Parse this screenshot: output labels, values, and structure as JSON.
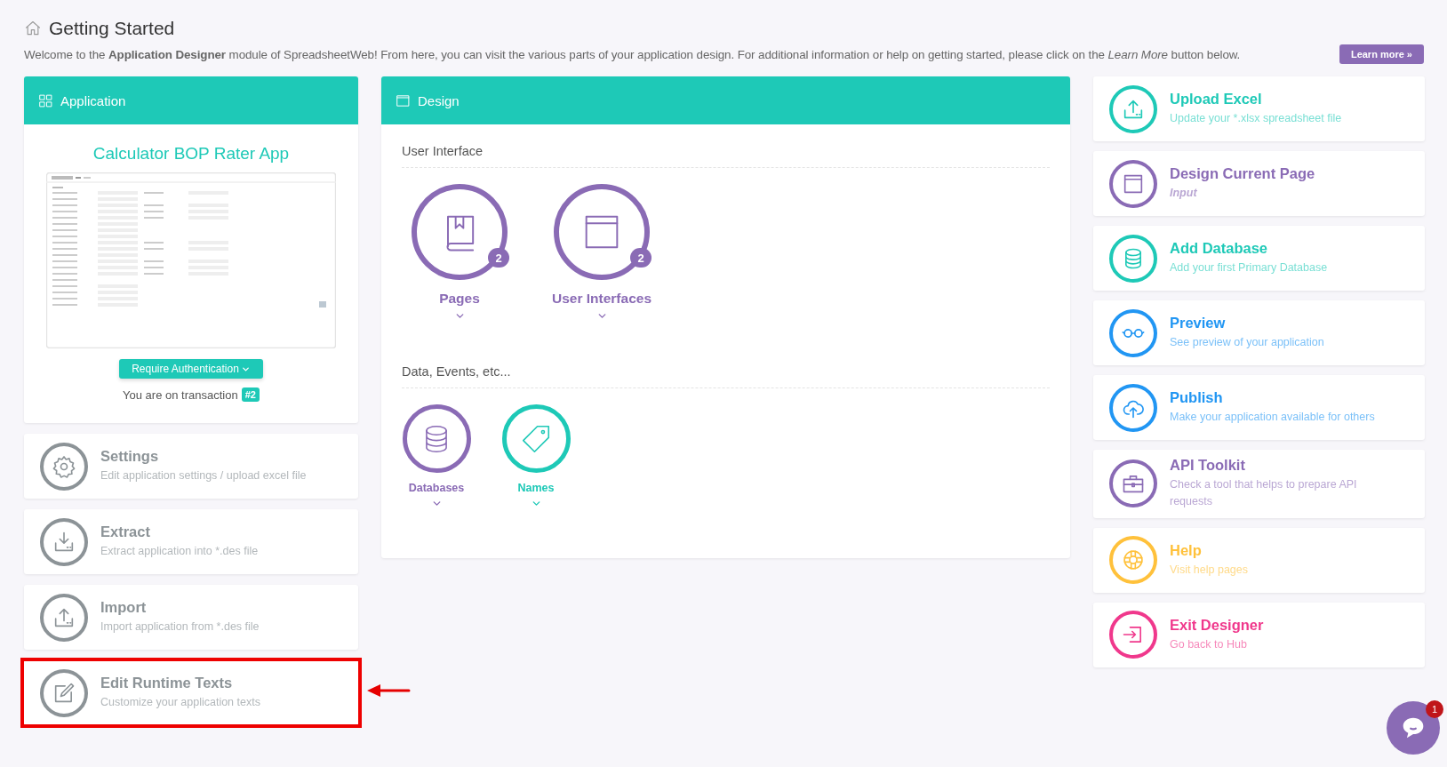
{
  "header": {
    "title": "Getting Started",
    "description": "Welcome to the **Application Designer** module of SpreadsheetWeb! From here, you can visit the various parts of your application design. For additional information or help on getting started, please click on the *Learn More* button below.",
    "learn_more": "Learn more »"
  },
  "application": {
    "title": "Application",
    "app_name": "Calculator BOP Rater App",
    "auth_button": "Require Authentication",
    "transaction_label": "You are on transaction",
    "transaction_badge": "#2"
  },
  "left_actions": [
    {
      "title": "Settings",
      "subtitle": "Edit application settings / upload excel file",
      "highlighted": false
    },
    {
      "title": "Extract",
      "subtitle": "Extract application into *.des file",
      "highlighted": false
    },
    {
      "title": "Import",
      "subtitle": "Import application from *.des file",
      "highlighted": false
    },
    {
      "title": "Edit Runtime Texts",
      "subtitle": "Customize your application texts",
      "highlighted": true
    }
  ],
  "design": {
    "title": "Design",
    "sections": [
      {
        "heading": "User Interface",
        "kind": "large",
        "items": [
          {
            "label": "Pages",
            "badge": "2",
            "color": "#8a6bb5"
          },
          {
            "label": "User Interfaces",
            "badge": "2",
            "color": "#8a6bb5"
          }
        ]
      },
      {
        "heading": "Data, Events, etc...",
        "kind": "small",
        "items": [
          {
            "label": "Databases",
            "color": "#8a6bb5"
          },
          {
            "label": "Names",
            "color": "#1ec9b7"
          }
        ]
      }
    ]
  },
  "right_actions": [
    {
      "title": "Upload Excel",
      "subtitle": "Update your *.xlsx spreadsheet file",
      "color": "#1ec9b7",
      "subtitle_emphasis": false
    },
    {
      "title": "Design Current Page",
      "subtitle": "Input",
      "color": "#8a6bb5",
      "subtitle_emphasis": true
    },
    {
      "title": "Add Database",
      "subtitle": "Add your first Primary Database",
      "color": "#1ec9b7",
      "subtitle_emphasis": false
    },
    {
      "title": "Preview",
      "subtitle": "See preview of your application",
      "color": "#2196f3",
      "subtitle_emphasis": false
    },
    {
      "title": "Publish",
      "subtitle": "Make your application available for others",
      "color": "#2196f3",
      "subtitle_emphasis": false
    },
    {
      "title": "API Toolkit",
      "subtitle": "Check a tool that helps to prepare API requests",
      "color": "#8a6bb5",
      "subtitle_emphasis": false
    },
    {
      "title": "Help",
      "subtitle": "Visit help pages",
      "color": "#ffc13b",
      "subtitle_emphasis": false
    },
    {
      "title": "Exit Designer",
      "subtitle": "Go back to Hub",
      "color": "#f0388c",
      "subtitle_emphasis": false
    }
  ],
  "chat": {
    "badge": "1"
  }
}
